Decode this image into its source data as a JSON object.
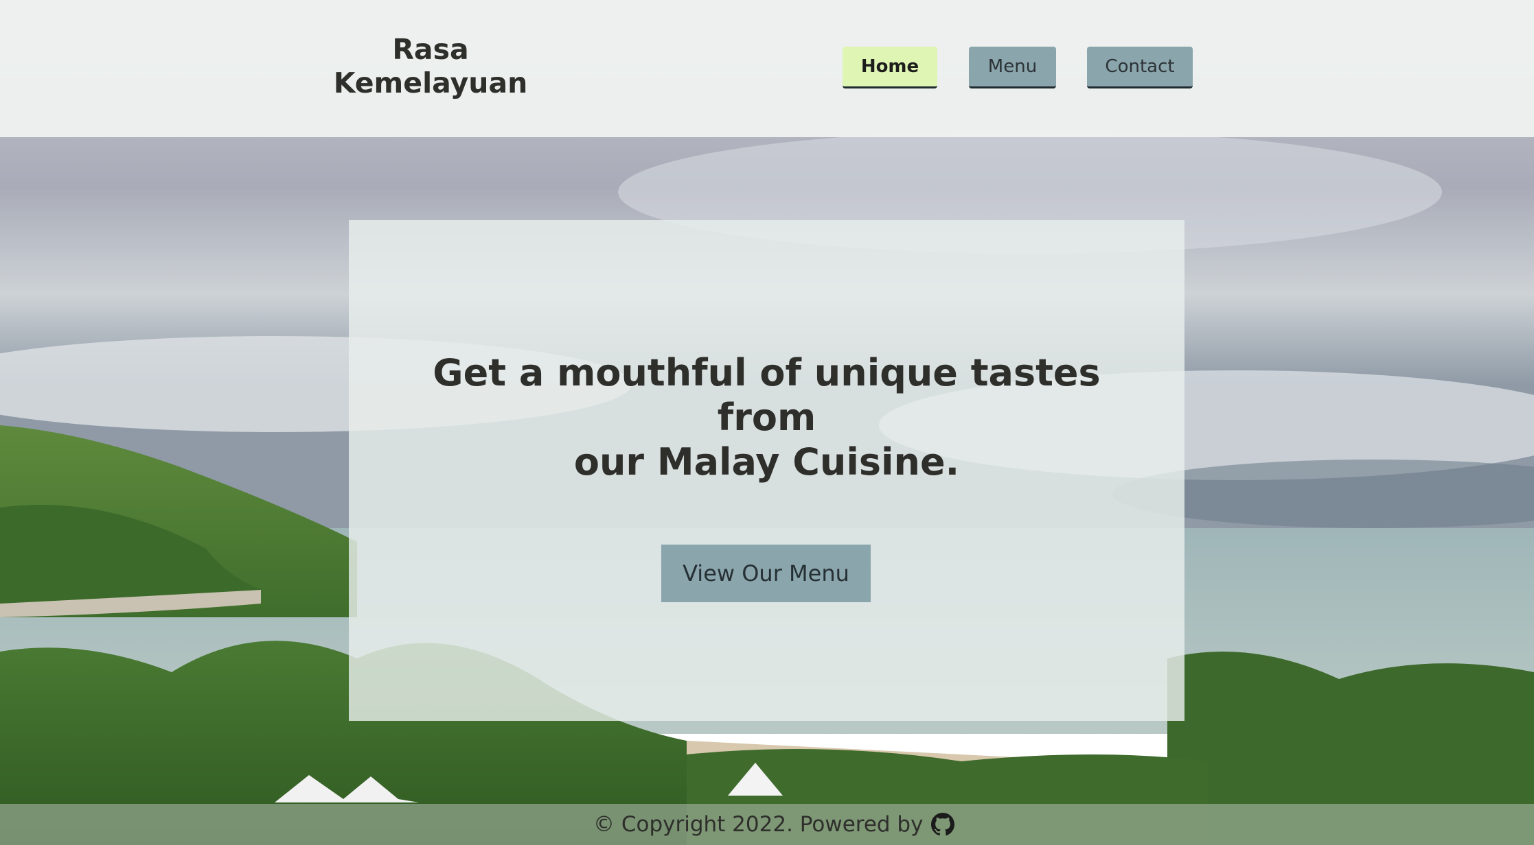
{
  "header": {
    "brand_line1": "Rasa",
    "brand_line2": "Kemelayuan",
    "nav": {
      "home_label": "Home",
      "menu_label": "Menu",
      "contact_label": "Contact",
      "active": "Home"
    }
  },
  "hero": {
    "title_line1": "Get a mouthful of unique tastes",
    "title_line2": "from",
    "title_line3": "our Malay Cuisine.",
    "cta_label": "View Our Menu"
  },
  "footer": {
    "copyright_text": "© Copyright 2022. Powered by",
    "powered_by_icon": "github-icon"
  },
  "colors": {
    "active_nav_bg": "#def5b4",
    "nav_bg": "#8ba5ad",
    "cta_bg": "#8ba5ad",
    "text": "#2e2e2b"
  }
}
